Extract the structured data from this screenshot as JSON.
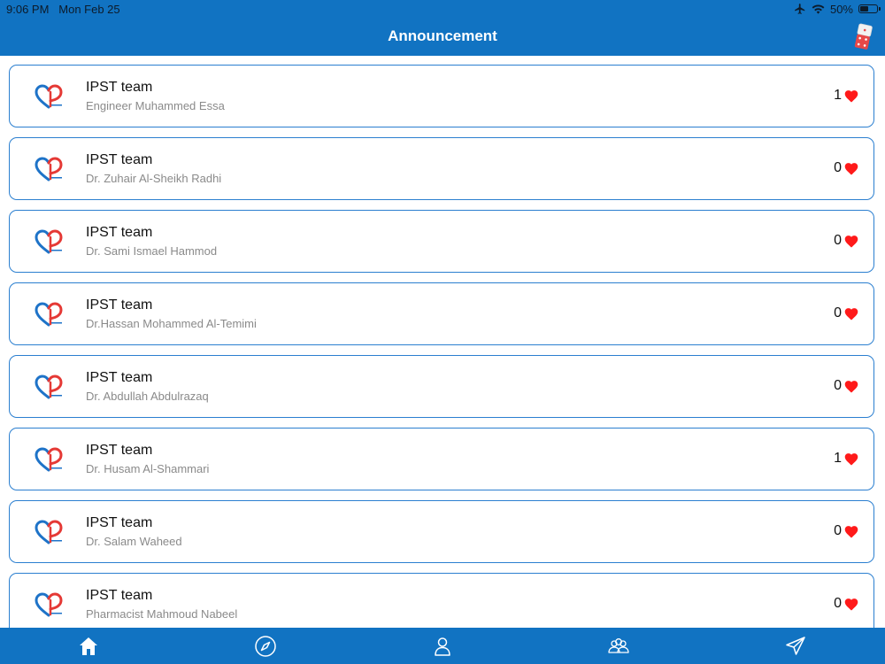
{
  "status_bar": {
    "time": "9:06 PM",
    "date": "Mon Feb 25",
    "battery": "50%",
    "battery_level": 0.5
  },
  "nav": {
    "title": "Announcement",
    "action_icon": "dice-icon"
  },
  "announcements": [
    {
      "title": "IPST team",
      "author": "Engineer Muhammed Essa",
      "likes": "1"
    },
    {
      "title": "IPST team",
      "author": "Dr. Zuhair Al-Sheikh Radhi",
      "likes": "0"
    },
    {
      "title": "IPST team",
      "author": "Dr. Sami Ismael Hammod",
      "likes": "0"
    },
    {
      "title": "IPST team",
      "author": "Dr.Hassan Mohammed Al-Temimi",
      "likes": "0"
    },
    {
      "title": "IPST team",
      "author": "Dr. Abdullah Abdulrazaq",
      "likes": "0"
    },
    {
      "title": "IPST team",
      "author": "Dr. Husam Al-Shammari",
      "likes": "1"
    },
    {
      "title": "IPST team",
      "author": "Dr. Salam Waheed",
      "likes": "0"
    },
    {
      "title": "IPST team",
      "author": "Pharmacist Mahmoud Nabeel",
      "likes": "0"
    }
  ],
  "tabs": [
    {
      "icon": "home-icon",
      "active": true
    },
    {
      "icon": "compass-icon",
      "active": false
    },
    {
      "icon": "person-icon",
      "active": false
    },
    {
      "icon": "group-icon",
      "active": false
    },
    {
      "icon": "send-icon",
      "active": false
    }
  ],
  "colors": {
    "primary": "#1173c2",
    "card_border": "#2b7fd0",
    "heart": "#ff1a1a",
    "logo_blue": "#1e73c8",
    "logo_red": "#e53935"
  }
}
